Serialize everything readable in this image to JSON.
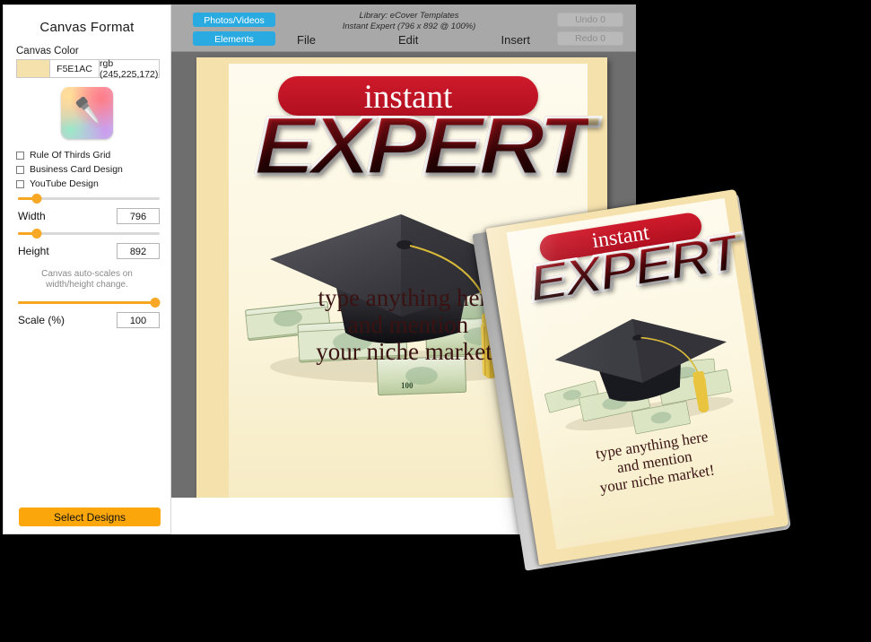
{
  "left_panel": {
    "title": "Canvas Format",
    "canvas_color_label": "Canvas Color",
    "color": {
      "hex": "F5E1AC",
      "rgb": "rgb (245,225,172)",
      "swatch_hex": "#F5E1AC"
    },
    "picker_icon": "eyedropper-icon",
    "checkboxes": [
      {
        "label": "Rule Of Thirds Grid",
        "checked": false
      },
      {
        "label": "Business Card Design",
        "checked": false
      },
      {
        "label": "YouTube Design",
        "checked": false
      }
    ],
    "width": {
      "label": "Width",
      "value": "796",
      "slider_percent": 13
    },
    "height": {
      "label": "Height",
      "value": "892",
      "slider_percent": 13
    },
    "note": "Canvas auto-scales on width/height change.",
    "scale": {
      "label": "Scale (%)",
      "value": "100",
      "slider_percent": 97
    },
    "select_designs_label": "Select Designs"
  },
  "toolbar": {
    "photos_videos_label": "Photos/Videos",
    "elements_label": "Elements",
    "library_line1": "Library: eCover Templates",
    "library_line2": "Instant Expert (796 x 892 @ 100%)",
    "menus": [
      "File",
      "Edit",
      "Insert"
    ],
    "undo_label": "Undo 0",
    "redo_label": "Redo 0",
    "accent_blue": "#29ABE2",
    "toolbar_bg": "#A8A8A8"
  },
  "cover": {
    "badge_text": "instant",
    "headline": "EXPERT",
    "tagline_line1": "type anything here",
    "tagline_line2": "and mention",
    "tagline_line3": "your niche market!",
    "illustration": "graduation-cap-on-money",
    "background_hex": "#F5E1AC",
    "inner_hex": "#FDF8E3",
    "badge_hex": "#C81E2B",
    "tagline_hex": "#3A1212"
  },
  "book_mock": {
    "badge_text": "instant",
    "headline": "EXPERT",
    "tagline_line1": "type anything here",
    "tagline_line2": "and mention",
    "tagline_line3": "your niche market!"
  }
}
